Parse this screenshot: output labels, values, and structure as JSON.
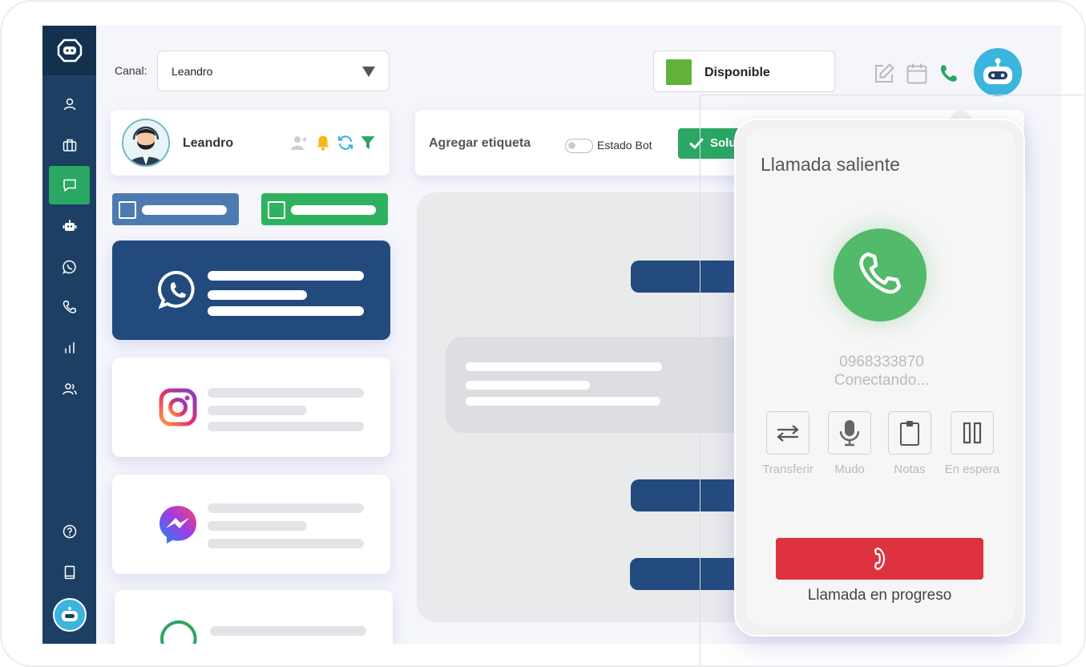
{
  "topbar": {
    "canal_label": "Canal:",
    "canal_value": "Leandro",
    "status_label": "Disponible",
    "status_color": "#62b23a"
  },
  "sidebar": {
    "items": [
      {
        "icon": "user-icon"
      },
      {
        "icon": "briefcase-icon"
      },
      {
        "icon": "chat-icon",
        "active": true
      },
      {
        "icon": "robot-icon"
      },
      {
        "icon": "whatsapp-icon"
      },
      {
        "icon": "phone-icon"
      },
      {
        "icon": "bar-chart-icon"
      },
      {
        "icon": "users-icon"
      },
      {
        "icon": "help-icon"
      },
      {
        "icon": "book-icon"
      }
    ]
  },
  "agent": {
    "name": "Leandro"
  },
  "channels": [
    {
      "icon": "whatsapp-icon",
      "selected": true
    },
    {
      "icon": "instagram-icon"
    },
    {
      "icon": "messenger-icon"
    },
    {
      "icon": "whatsapp-icon"
    }
  ],
  "chat": {
    "tag_label": "Agregar etiqueta",
    "bot_state_label": "Estado Bot",
    "solve_label": "Solu"
  },
  "call": {
    "title": "Llamada saliente",
    "number": "0968333870",
    "state": "Conectando...",
    "controls": [
      {
        "label": "Transferir",
        "icon": "transfer-icon"
      },
      {
        "label": "Mudo",
        "icon": "mic-icon"
      },
      {
        "label": "Notas",
        "icon": "notes-icon"
      },
      {
        "label": "En espera",
        "icon": "pause-icon"
      }
    ],
    "progress": "Llamada en progreso",
    "accent_green": "#53b96b",
    "hangup_color": "#de3240"
  },
  "colors": {
    "sidebar": "#1d3f63",
    "active": "#2aa763",
    "primary_dark": "#224a7d",
    "bot_blue": "#3bb5de"
  }
}
